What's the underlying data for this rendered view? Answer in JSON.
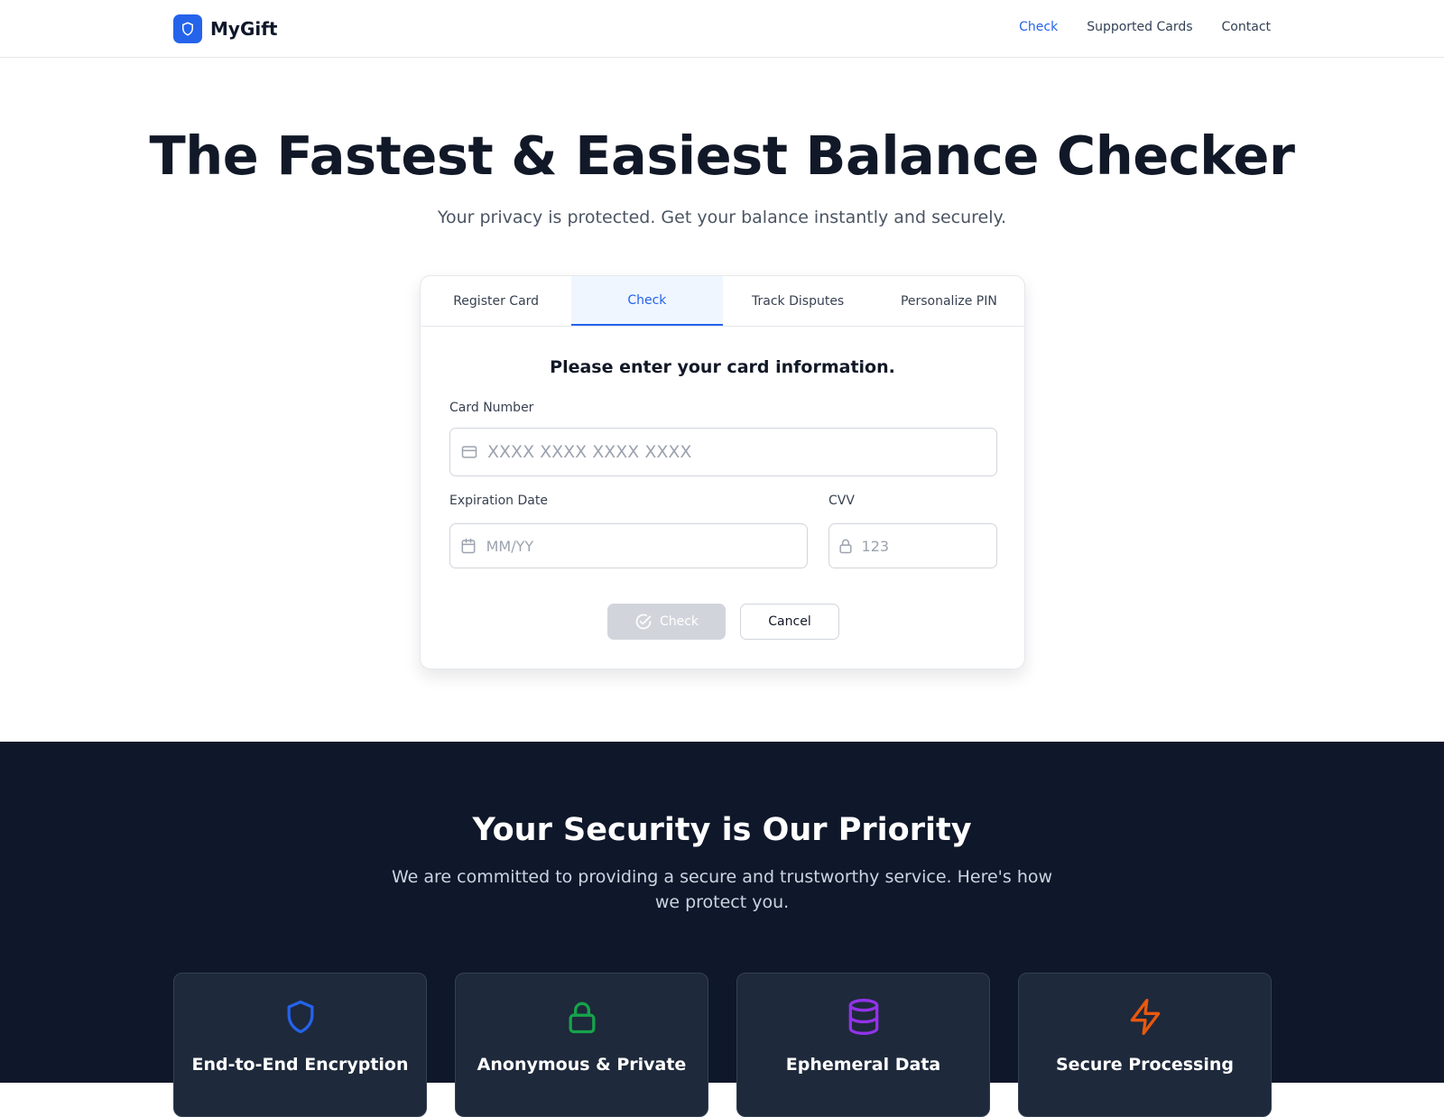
{
  "header": {
    "logo_text": "MyGift",
    "nav": [
      {
        "label": "Check",
        "active": true
      },
      {
        "label": "Supported Cards"
      },
      {
        "label": "Contact"
      }
    ]
  },
  "hero": {
    "title": "The Fastest & Easiest Balance Checker",
    "subtitle": "Your privacy is protected. Get your balance instantly and securely."
  },
  "card": {
    "tabs": [
      {
        "label": "Register Card"
      },
      {
        "label": "Check",
        "active": true
      },
      {
        "label": "Track Disputes"
      },
      {
        "label": "Personalize PIN"
      }
    ],
    "form_title": "Please enter your card information.",
    "card_number": {
      "label": "Card Number",
      "value": "",
      "placeholder": "XXXX XXXX XXXX XXXX",
      "icon": "credit-card-icon"
    },
    "expiration": {
      "label": "Expiration Date",
      "value": "",
      "placeholder": "MM/YY",
      "icon": "calendar-icon"
    },
    "cvv": {
      "label": "CVV",
      "value": "",
      "placeholder": "123",
      "icon": "lock-icon"
    },
    "check_label": "Check",
    "cancel_label": "Cancel"
  },
  "security": {
    "title": "Your Security is Our Priority",
    "subtitle": "We are committed to providing a secure and trustworthy service. Here's how we protect you.",
    "features": [
      {
        "title": "End-to-End Encryption",
        "icon": "shield-icon",
        "color": "#2563eb"
      },
      {
        "title": "Anonymous & Private",
        "icon": "lock-icon",
        "color": "#16a34a"
      },
      {
        "title": "Ephemeral Data",
        "icon": "database-icon",
        "color": "#9333ea"
      },
      {
        "title": "Secure Processing",
        "icon": "lightning-icon",
        "color": "#ea580c"
      }
    ]
  },
  "colors": {
    "accent": "#2563eb",
    "dark_bg": "#0f172a"
  }
}
